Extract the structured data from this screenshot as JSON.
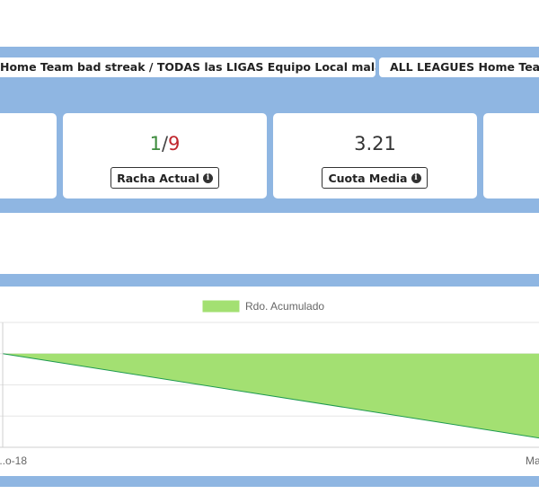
{
  "tabs": [
    {
      "label": "Home Team bad streak / TODAS las LIGAS Equipo Local mala racha"
    },
    {
      "label": "ALL LEAGUES Home Team bad streak"
    }
  ],
  "stats": {
    "current_streak": {
      "wins": "1",
      "separator": "/",
      "losses": "9",
      "label": "Racha Actual"
    },
    "avg_odds": {
      "value": "3.21",
      "label": "Cuota Media"
    }
  },
  "colors": {
    "band": "#8fb6e2",
    "wins": "#3d8b3d",
    "losses": "#c0262d",
    "area_fill": "#a3e072",
    "area_line": "#1e9a50"
  },
  "chart_data": {
    "type": "area",
    "legend": [
      {
        "name": "Rdo. Acumulado",
        "color": "#a3e072"
      }
    ],
    "legend_position": "top-center",
    "x_ticks": [
      "...o-18",
      "Ma..."
    ],
    "series": [
      {
        "name": "Rdo. Acumulado",
        "points": [
          {
            "x": 0,
            "y": -1
          },
          {
            "x": 1,
            "y": -3.7
          }
        ]
      }
    ],
    "ylim": [
      -4,
      0
    ],
    "y_grid_values": [
      0,
      -1,
      -2,
      -3,
      -4
    ],
    "baseline": -1,
    "grid": true
  }
}
